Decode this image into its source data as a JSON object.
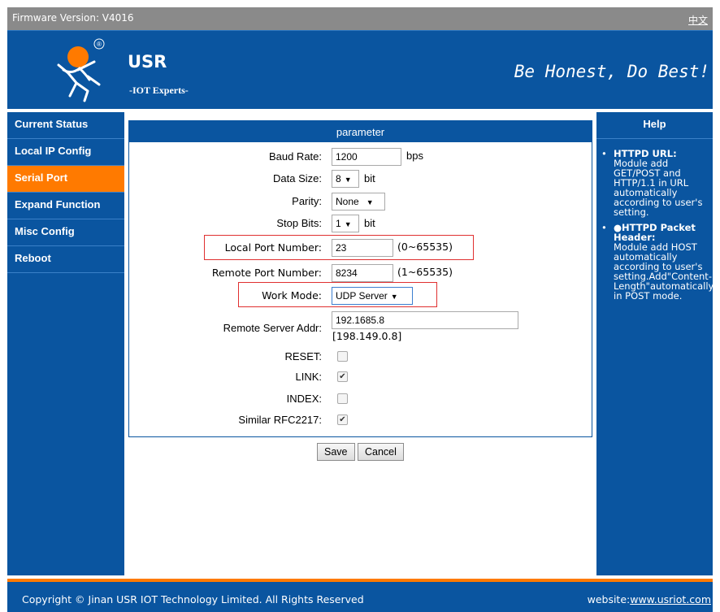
{
  "topbar": {
    "firmware_label": "Firmware Version: V4016",
    "language_link": "中文"
  },
  "header": {
    "brand": "USR",
    "tagline": "-IOT Experts-",
    "slogan": "Be Honest, Do Best!",
    "logo_icon": "runner-logo-icon",
    "registered_mark": "®"
  },
  "sidebar": {
    "items": [
      {
        "label": "Current Status",
        "active": false
      },
      {
        "label": "Local IP Config",
        "active": false
      },
      {
        "label": "Serial Port",
        "active": true
      },
      {
        "label": "Expand Function",
        "active": false
      },
      {
        "label": "Misc Config",
        "active": false
      },
      {
        "label": "Reboot",
        "active": false
      }
    ]
  },
  "panel": {
    "title": "parameter",
    "baud_rate": {
      "label": "Baud Rate:",
      "value": "1200",
      "unit": "bps"
    },
    "data_size": {
      "label": "Data Size:",
      "value": "8",
      "unit": "bit"
    },
    "parity": {
      "label": "Parity:",
      "value": "None"
    },
    "stop_bits": {
      "label": "Stop Bits:",
      "value": "1",
      "unit": "bit"
    },
    "local_port": {
      "label": "Local Port Number:",
      "value": "23",
      "range": "(0~65535)"
    },
    "remote_port": {
      "label": "Remote Port Number:",
      "value": "8234",
      "range": "(1~65535)"
    },
    "work_mode": {
      "label": "Work Mode:",
      "value": "UDP Server"
    },
    "remote_server": {
      "label": "Remote Server Addr:",
      "value": "192.1685.8",
      "resolved": "[198.149.0.8]"
    },
    "reset": {
      "label": "RESET:",
      "checked": false
    },
    "link": {
      "label": "LINK:",
      "checked": true
    },
    "index": {
      "label": "INDEX:",
      "checked": false
    },
    "rfc2217": {
      "label": "Similar RFC2217:",
      "checked": true
    }
  },
  "buttons": {
    "save": "Save",
    "cancel": "Cancel"
  },
  "help": {
    "title": "Help",
    "items": [
      {
        "bullet": "•",
        "heading": "HTTPD URL:",
        "text": "Module add GET/POST and HTTP/1.1 in URL automatically according to user's setting."
      },
      {
        "bullet": "•",
        "heading": "●HTTPD Packet Header:",
        "text": "Module add HOST automatically according to user's setting.Add\"Content-Length\"automatically in POST mode."
      }
    ]
  },
  "footer": {
    "copyright": "Copyright © Jinan USR IOT Technology Limited. All Rights Reserved",
    "website_label": "website:",
    "website_link": "www.usriot.com"
  },
  "colors": {
    "primary_blue": "#0a55a0",
    "accent_orange": "#ff7a00",
    "topbar_gray": "#8a8a8a",
    "highlight_red": "#e03030"
  }
}
